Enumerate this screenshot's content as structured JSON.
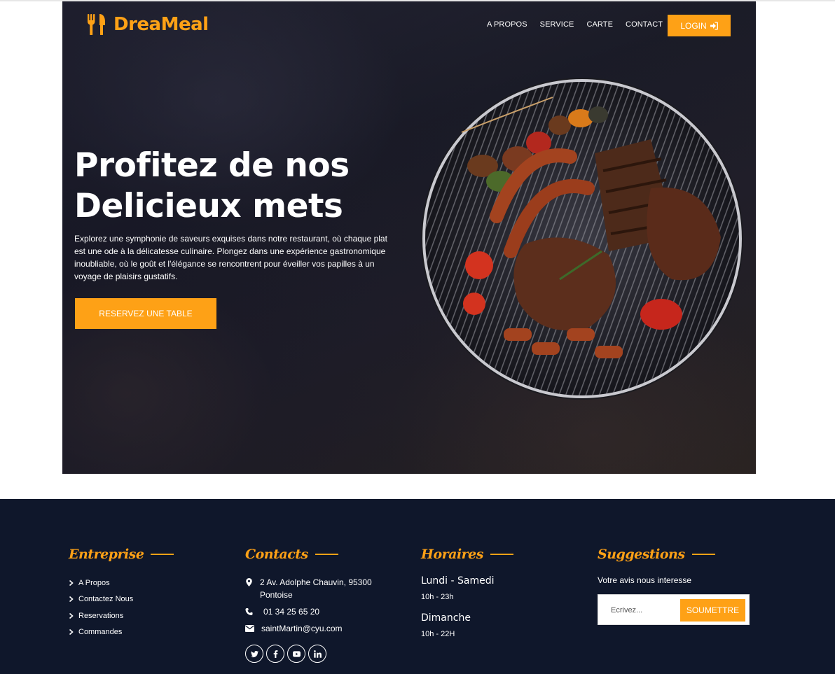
{
  "brand": {
    "name": "DreaMeal",
    "accent_color": "#fea116",
    "logo_icon": "utensils-icon"
  },
  "nav": {
    "items": [
      "A PROPOS",
      "SERVICE",
      "CARTE",
      "CONTACT"
    ],
    "login_label": "LOGIN",
    "login_icon": "sign-in-icon"
  },
  "hero": {
    "title_line1": "Profitez de nos",
    "title_line2": "Delicieux mets",
    "description": "Explorez une symphonie de saveurs exquises dans notre restaurant, où chaque plat est une ode à la délicatesse culinaire. Plongez dans une expérience gastronomique inoubliable, où le goût et l'élégance se rencontrent pour éveiller vos papilles à un voyage de plaisirs gustatifs.",
    "cta_label": "RESERVEZ UNE TABLE",
    "image": "grilled-meat-barbecue-image"
  },
  "footer": {
    "background": "#0f172b",
    "entreprise": {
      "title": "Entreprise",
      "links": [
        "A Propos",
        "Contactez Nous",
        "Reservations",
        "Commandes"
      ]
    },
    "contacts": {
      "title": "Contacts",
      "address": "2 Av. Adolphe Chauvin, 95300 Pontoise",
      "phone": "01 34 25 65 20",
      "email": "saintMartin@cyu.com",
      "socials": [
        "twitter-icon",
        "facebook-icon",
        "youtube-icon",
        "linkedin-icon"
      ]
    },
    "horaires": {
      "title": "Horaires",
      "day1": "Lundi - Samedi",
      "time1": "10h - 23h",
      "day2": "Dimanche",
      "time2": "10h - 22H"
    },
    "suggestions": {
      "title": "Suggestions",
      "text": "Votre avis nous interesse",
      "placeholder": "Ecrivez...",
      "submit_label": "SOUMETTRE"
    }
  }
}
